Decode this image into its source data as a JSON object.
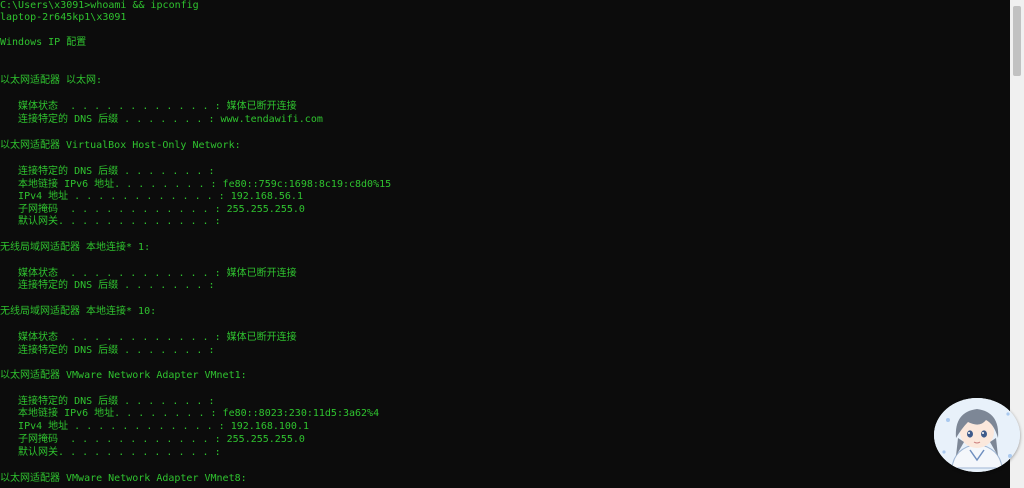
{
  "console": {
    "lines": [
      "C:\\Users\\x3091>whoami && ipconfig",
      "laptop-2r645kp1\\x3091",
      "",
      "Windows IP 配置",
      "",
      "",
      "以太网适配器 以太网:",
      "",
      "   媒体状态  . . . . . . . . . . . . : 媒体已断开连接",
      "   连接特定的 DNS 后缀 . . . . . . . : www.tendawifi.com",
      "",
      "以太网适配器 VirtualBox Host-Only Network:",
      "",
      "   连接特定的 DNS 后缀 . . . . . . . :",
      "   本地链接 IPv6 地址. . . . . . . . : fe80::759c:1698:8c19:c8d0%15",
      "   IPv4 地址 . . . . . . . . . . . . : 192.168.56.1",
      "   子网掩码  . . . . . . . . . . . . : 255.255.255.0",
      "   默认网关. . . . . . . . . . . . . :",
      "",
      "无线局域网适配器 本地连接* 1:",
      "",
      "   媒体状态  . . . . . . . . . . . . : 媒体已断开连接",
      "   连接特定的 DNS 后缀 . . . . . . . :",
      "",
      "无线局域网适配器 本地连接* 10:",
      "",
      "   媒体状态  . . . . . . . . . . . . : 媒体已断开连接",
      "   连接特定的 DNS 后缀 . . . . . . . :",
      "",
      "以太网适配器 VMware Network Adapter VMnet1:",
      "",
      "   连接特定的 DNS 后缀 . . . . . . . :",
      "   本地链接 IPv6 地址. . . . . . . . : fe80::8023:230:11d5:3a62%4",
      "   IPv4 地址 . . . . . . . . . . . . : 192.168.100.1",
      "   子网掩码  . . . . . . . . . . . . : 255.255.255.0",
      "   默认网关. . . . . . . . . . . . . :",
      "",
      "以太网适配器 VMware Network Adapter VMnet8:"
    ]
  },
  "colors": {
    "background": "#0c0c0c",
    "text": "#2fc32f",
    "scrollbar": "#f0f0f0"
  },
  "icons": {
    "avatar": "anime-avatar-icon"
  }
}
